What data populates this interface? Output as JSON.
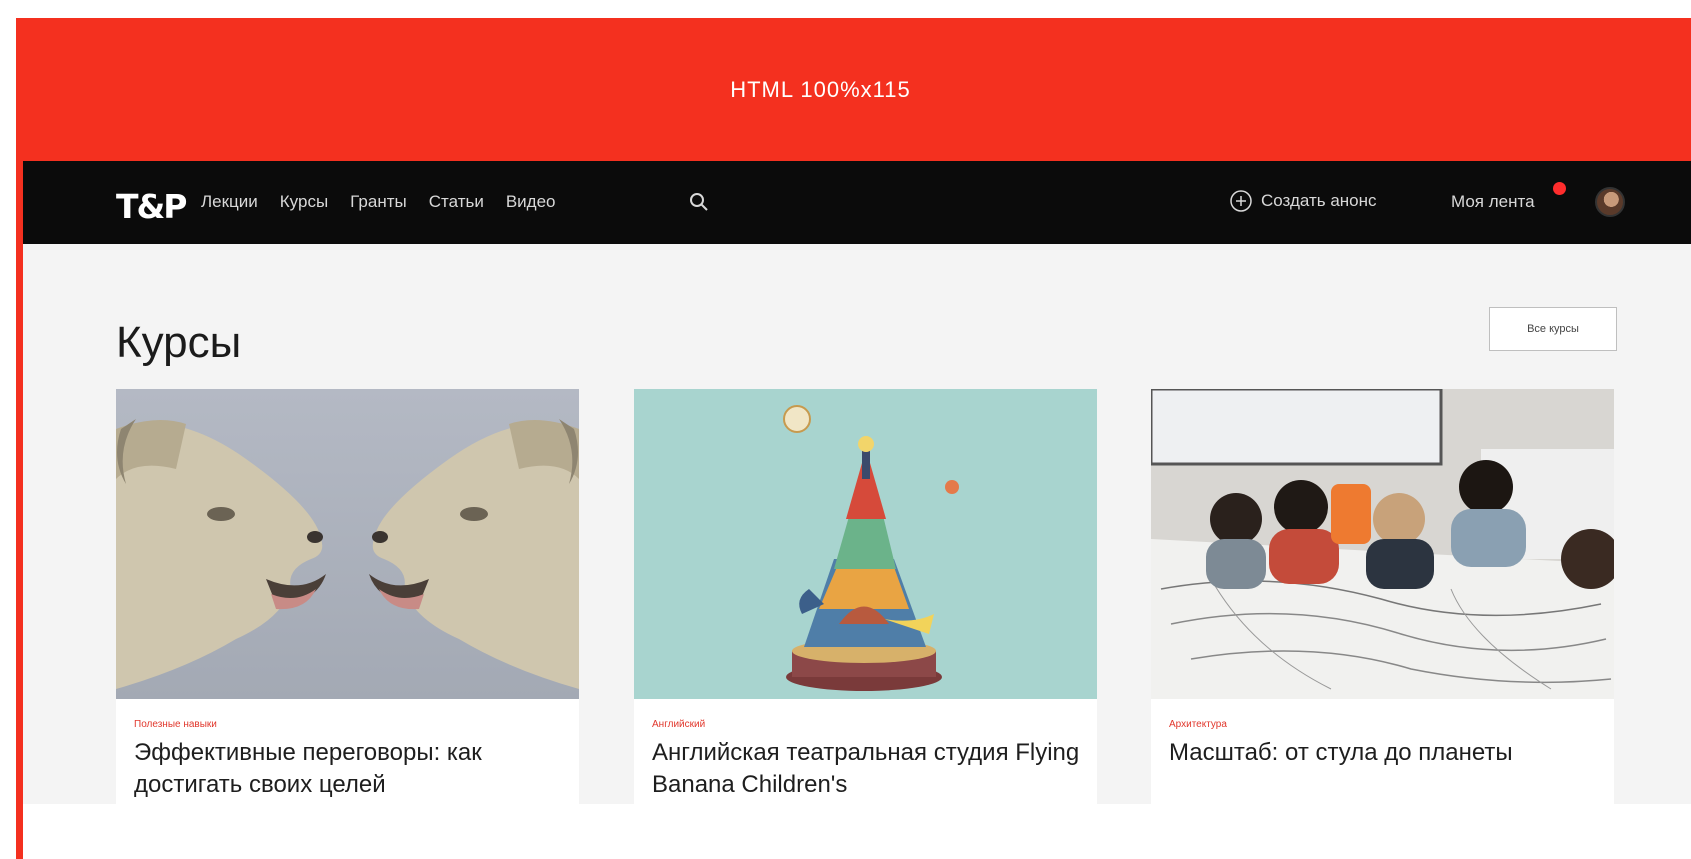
{
  "banner": {
    "text": "HTML 100%x115"
  },
  "navbar": {
    "logo": "T&P",
    "items": [
      "Лекции",
      "Курсы",
      "Гранты",
      "Статьи",
      "Видео"
    ],
    "create_ad_label": "Создать анонс",
    "my_feed_label": "Моя лента",
    "notification_count": ""
  },
  "courses": {
    "title": "Курсы",
    "all_button": "Все курсы",
    "cards": [
      {
        "category": "Полезные навыки",
        "title": "Эффективные переговоры: как достигать своих целей"
      },
      {
        "category": "Английский",
        "title": "Английская театральная студия Flying Banana Children's"
      },
      {
        "category": "Архитектура",
        "title": "Масштаб: от стула до планеты"
      }
    ]
  },
  "colors": {
    "accent_red": "#f4301f",
    "navbar_bg": "#0b0b0b",
    "page_bg": "#f4f4f4",
    "category_red": "#e1372c"
  }
}
